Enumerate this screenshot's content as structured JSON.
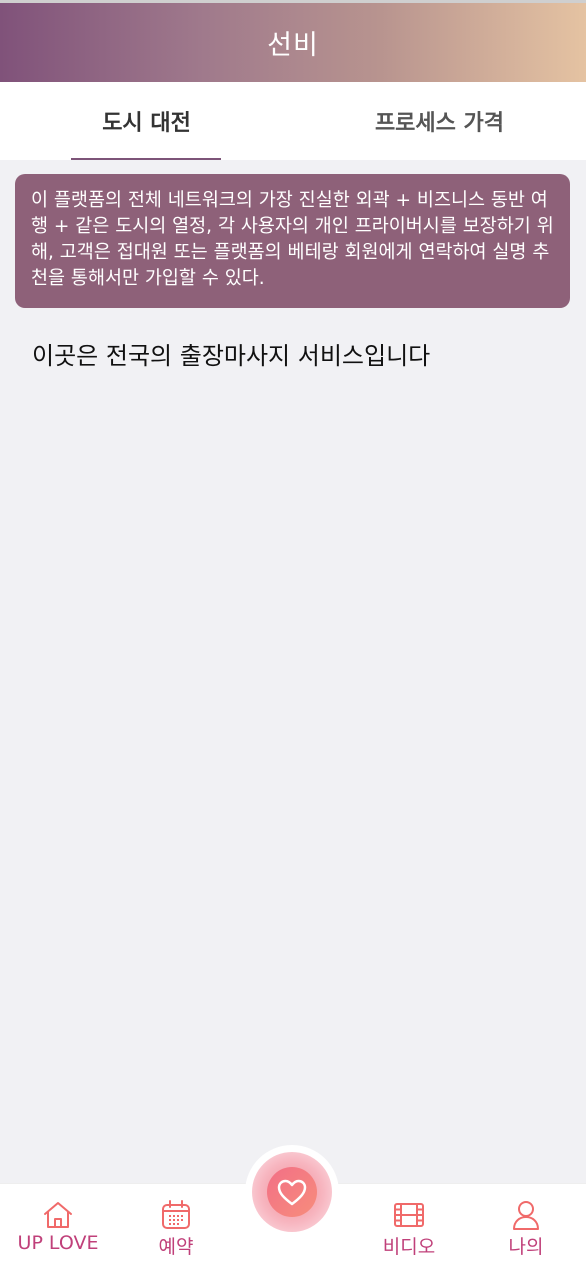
{
  "header": {
    "title": "선비"
  },
  "tabs": [
    {
      "label": "도시 대전",
      "active": true
    },
    {
      "label": "프로세스 가격",
      "active": false
    }
  ],
  "notice": {
    "text": "이 플랫폼의 전체 네트워크의 가장 진실한 외곽 + 비즈니스 동반 여행 + 같은 도시의 열정, 각 사용자의 개인 프라이버시를 보장하기 위해, 고객은 접대원 또는 플랫폼의 베테랑 회원에게 연락하여 실명 추천을 통해서만 가입할 수 있다."
  },
  "content": {
    "text": "이곳은 전국의 출장마사지 서비스입니다"
  },
  "bottom_nav": {
    "home": {
      "label": "UP LOVE",
      "icon": "home-icon"
    },
    "reserve": {
      "label": "예약",
      "icon": "calendar-icon"
    },
    "center": {
      "icon": "heart-icon"
    },
    "video": {
      "label": "비디오",
      "icon": "film-icon"
    },
    "me": {
      "label": "나의",
      "icon": "user-icon"
    }
  },
  "colors": {
    "accent": "#7d5478",
    "notice_bg": "#8e6179",
    "nav_label": "#c0407a",
    "nav_icon": "#f06a6a"
  }
}
